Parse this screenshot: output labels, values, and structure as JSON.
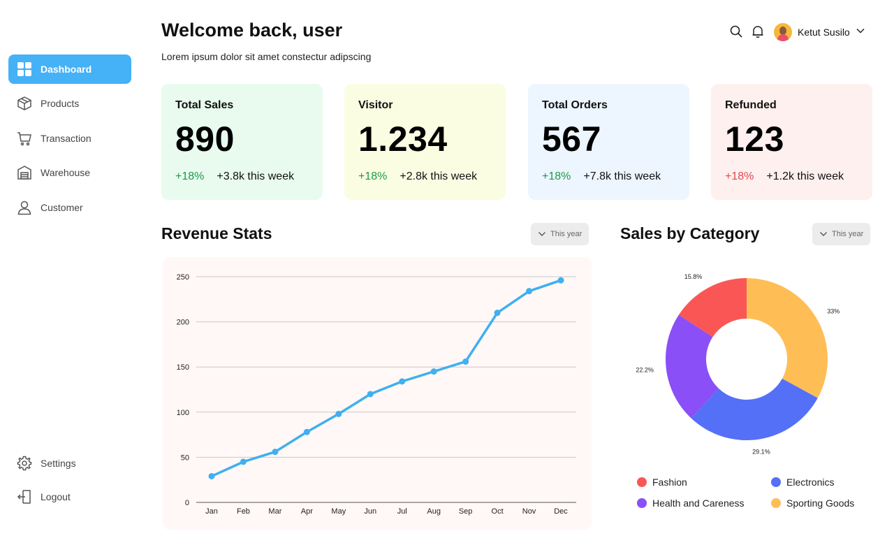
{
  "sidebar": {
    "items": [
      {
        "label": "Dashboard",
        "icon": "grid-icon",
        "active": true
      },
      {
        "label": "Products",
        "icon": "box-icon",
        "active": false
      },
      {
        "label": "Transaction",
        "icon": "cart-icon",
        "active": false
      },
      {
        "label": "Warehouse",
        "icon": "warehouse-icon",
        "active": false
      },
      {
        "label": "Customer",
        "icon": "user-icon",
        "active": false
      }
    ],
    "bottom": [
      {
        "label": "Settings",
        "icon": "gear-icon"
      },
      {
        "label": "Logout",
        "icon": "logout-icon"
      }
    ]
  },
  "header": {
    "title": "Welcome back, user",
    "subtitle": "Lorem ipsum dolor sit amet constectur adipscing",
    "user_name": "Ketut Susilo"
  },
  "cards": [
    {
      "title": "Total Sales",
      "value": "890",
      "pct": "+18%",
      "week": "+3.8k this week",
      "bg": "#e8fbee",
      "pct_color": "#1a9a4a"
    },
    {
      "title": "Visitor",
      "value": "1.234",
      "pct": "+18%",
      "week": "+2.8k this week",
      "bg": "#fbfde2",
      "pct_color": "#1a9a4a"
    },
    {
      "title": "Total Orders",
      "value": "567",
      "pct": "+18%",
      "week": "+7.8k this week",
      "bg": "#edf5fe",
      "pct_color": "#1a9a4a"
    },
    {
      "title": "Refunded",
      "value": "123",
      "pct": "+18%",
      "week": "+1.2k this week",
      "bg": "#fdf0ef",
      "pct_color": "#e5484d"
    }
  ],
  "revenue": {
    "title": "Revenue Stats",
    "period": "This year"
  },
  "sales_category": {
    "title": "Sales by Category",
    "period": "This year"
  },
  "chart_data": [
    {
      "type": "line",
      "categories": [
        "Jan",
        "Feb",
        "Mar",
        "Apr",
        "May",
        "Jun",
        "Jul",
        "Aug",
        "Sep",
        "Oct",
        "Nov",
        "Dec"
      ],
      "values": [
        29,
        45,
        56,
        78,
        98,
        120,
        134,
        145,
        156,
        210,
        234,
        246
      ],
      "ylim": [
        0,
        250
      ],
      "yticks": [
        0,
        50,
        100,
        150,
        200,
        250
      ],
      "grid": true,
      "color": "#3fb0f0"
    },
    {
      "type": "pie",
      "donut": true,
      "slices": [
        {
          "label": "Sporting Goods",
          "value": 33,
          "text": "33%",
          "color": "#ffbe55"
        },
        {
          "label": "Electronics",
          "value": 29.1,
          "text": "29.1%",
          "color": "#5470f7"
        },
        {
          "label": "Health and Careness",
          "value": 22.2,
          "text": "22.2%",
          "color": "#8a4ff7"
        },
        {
          "label": "Fashion",
          "value": 15.8,
          "text": "15.8%",
          "color": "#fa5656"
        }
      ],
      "legend": [
        "Fashion",
        "Electronics",
        "Health and Careness",
        "Sporting Goods"
      ],
      "legend_colors": [
        "#fa5656",
        "#5470f7",
        "#8a4ff7",
        "#ffbe55"
      ]
    }
  ]
}
